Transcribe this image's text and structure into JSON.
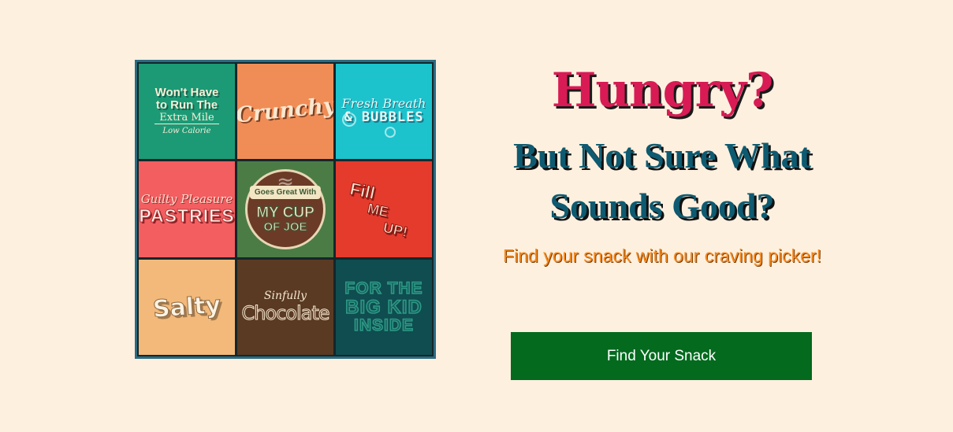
{
  "tiles": [
    {
      "name": "low-calorie",
      "lines": [
        "Won't Have",
        "to Run The",
        "Extra Mile",
        "Low Calorie"
      ],
      "color": "#1c9a76"
    },
    {
      "name": "crunchy",
      "lines": [
        "Crunchy"
      ],
      "color": "#f08d57"
    },
    {
      "name": "fresh-breath-bubbles",
      "lines": [
        "Fresh Breath",
        "& BUBBLES"
      ],
      "color": "#1cc3cd"
    },
    {
      "name": "guilty-pleasure-pastries",
      "lines": [
        "Guilty Pleasure",
        "PASTRIES"
      ],
      "color": "#f35e60"
    },
    {
      "name": "goes-great-with-my-cup-of-joe",
      "lines": [
        "Goes Great With",
        "MY CUP",
        "OF JOE"
      ],
      "color": "#4c7c45"
    },
    {
      "name": "fill-me-up",
      "lines": [
        "Fill",
        "ME",
        "UP!"
      ],
      "color": "#e53b2d"
    },
    {
      "name": "salty",
      "lines": [
        "Salty"
      ],
      "color": "#f2b97a"
    },
    {
      "name": "sinfully-chocolate",
      "lines": [
        "Sinfully",
        "Chocolate"
      ],
      "color": "#5a3a23"
    },
    {
      "name": "for-the-big-kid-inside",
      "lines": [
        "FOR THE",
        "BIG KID",
        "INSIDE"
      ],
      "color": "#0f4d50"
    }
  ],
  "hero": {
    "title": "Hungry?",
    "subtitle_line1": "But Not Sure What",
    "subtitle_line2": "Sounds Good?",
    "tagline": "Find your snack with our craving picker!"
  },
  "cta": {
    "label": "Find Your Snack",
    "color": "#036a1e"
  },
  "colors": {
    "background": "#fdf0df",
    "title": "#d81b54",
    "subtitle": "#0e5a70",
    "tagline": "#f58a1f"
  }
}
